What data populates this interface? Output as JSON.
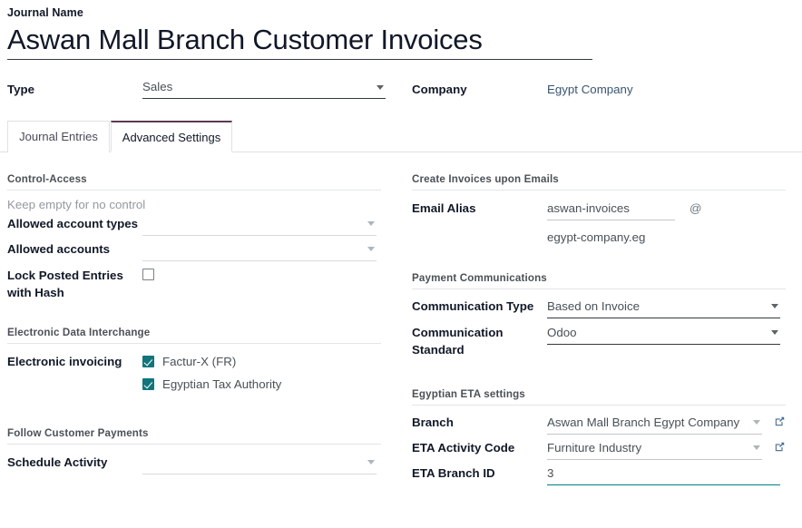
{
  "header": {
    "journal_name_label": "Journal Name",
    "journal_name_value": "Aswan Mall Branch Customer Invoices",
    "type_label": "Type",
    "type_value": "Sales",
    "company_label": "Company",
    "company_value": "Egypt Company"
  },
  "tabs": [
    {
      "label": "Journal Entries",
      "active": false
    },
    {
      "label": "Advanced Settings",
      "active": true
    }
  ],
  "left": {
    "control_access": {
      "section_title": "Control-Access",
      "helper_text": "Keep empty for no control",
      "allowed_account_types_label": "Allowed account types",
      "allowed_account_types_value": "",
      "allowed_accounts_label": "Allowed accounts",
      "allowed_accounts_value": "",
      "lock_posted_label_line1": "Lock Posted Entries",
      "lock_posted_label_line2": "with Hash",
      "lock_posted_checked": false
    },
    "edi": {
      "section_title": "Electronic Data Interchange",
      "electronic_invoicing_label": "Electronic invoicing",
      "options": [
        {
          "label": "Factur-X (FR)",
          "checked": true
        },
        {
          "label": "Egyptian Tax Authority",
          "checked": true
        }
      ]
    },
    "follow_payments": {
      "section_title": "Follow Customer Payments",
      "schedule_activity_label": "Schedule Activity",
      "schedule_activity_value": ""
    }
  },
  "right": {
    "emails": {
      "section_title": "Create Invoices upon Emails",
      "email_alias_label": "Email Alias",
      "email_alias_value": "aswan-invoices",
      "at_symbol": "@",
      "email_domain": "egypt-company.eg"
    },
    "payment_comms": {
      "section_title": "Payment Communications",
      "communication_type_label": "Communication Type",
      "communication_type_value": "Based on Invoice",
      "communication_standard_label_line1": "Communication",
      "communication_standard_label_line2": "Standard",
      "communication_standard_value": "Odoo"
    },
    "eta": {
      "section_title": "Egyptian ETA settings",
      "branch_label": "Branch",
      "branch_value": "Aswan Mall Branch Egypt Company",
      "activity_code_label": "ETA Activity Code",
      "activity_code_value": "Furniture Industry",
      "branch_id_label": "ETA Branch ID",
      "branch_id_value": "3"
    }
  },
  "colors": {
    "accent_teal": "#12757c",
    "tab_active_border": "#5d3a52",
    "link_blue": "#39556f",
    "muted": "#9499a0"
  }
}
